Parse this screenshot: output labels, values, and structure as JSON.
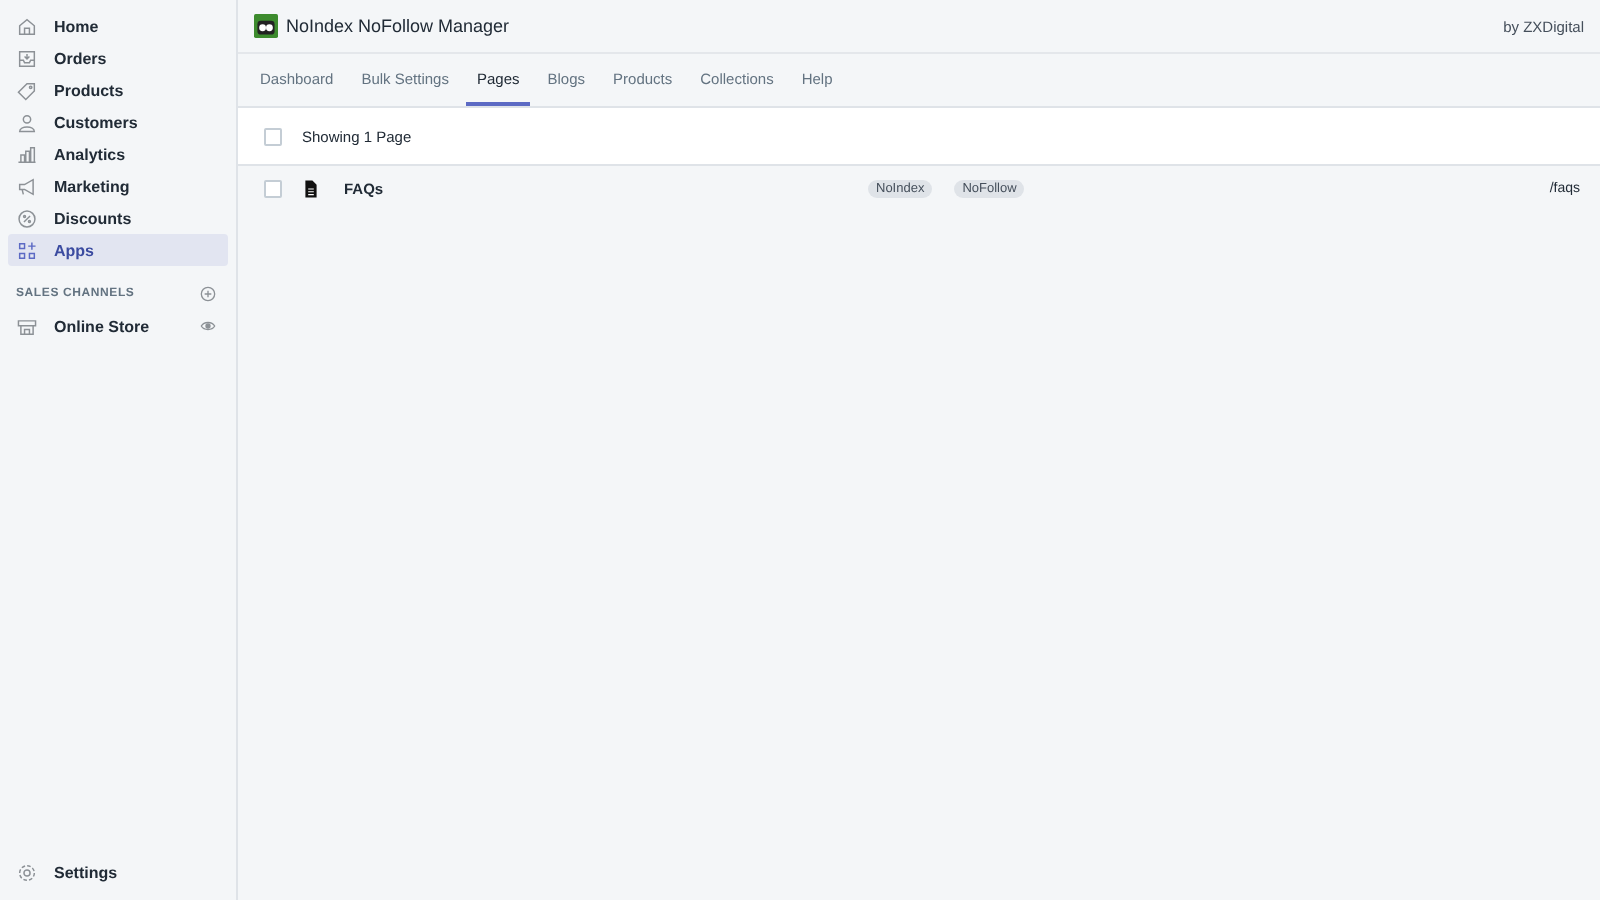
{
  "sidebar": {
    "items": [
      {
        "label": "Home",
        "selected": false
      },
      {
        "label": "Orders",
        "selected": false
      },
      {
        "label": "Products",
        "selected": false
      },
      {
        "label": "Customers",
        "selected": false
      },
      {
        "label": "Analytics",
        "selected": false
      },
      {
        "label": "Marketing",
        "selected": false
      },
      {
        "label": "Discounts",
        "selected": false
      },
      {
        "label": "Apps",
        "selected": true
      }
    ],
    "section_title": "SALES CHANNELS",
    "channels": [
      {
        "label": "Online Store"
      }
    ],
    "footer_item": "Settings"
  },
  "app": {
    "title": "NoIndex NoFollow Manager",
    "byline": "by ZXDigital"
  },
  "tabs": [
    {
      "label": "Dashboard",
      "selected": false
    },
    {
      "label": "Bulk Settings",
      "selected": false
    },
    {
      "label": "Pages",
      "selected": true
    },
    {
      "label": "Blogs",
      "selected": false
    },
    {
      "label": "Products",
      "selected": false
    },
    {
      "label": "Collections",
      "selected": false
    },
    {
      "label": "Help",
      "selected": false
    }
  ],
  "list": {
    "header": "Showing 1 Page",
    "header_checked": false,
    "rows": [
      {
        "title": "FAQs",
        "checked": false,
        "tags": [
          "NoIndex",
          "NoFollow"
        ],
        "path": "/faqs"
      }
    ]
  }
}
